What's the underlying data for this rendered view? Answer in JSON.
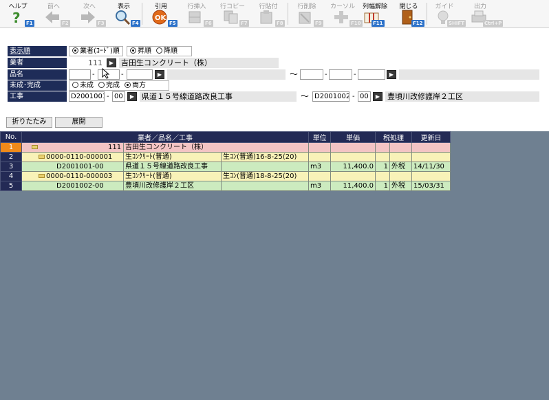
{
  "toolbar": {
    "help": {
      "label": "ヘルプ",
      "key": "F1"
    },
    "prev": {
      "label": "前へ",
      "key": "F2"
    },
    "next": {
      "label": "次へ",
      "key": "F3"
    },
    "display": {
      "label": "表示",
      "key": "F4"
    },
    "quote": {
      "label": "引用",
      "key": "F5"
    },
    "row_insert": {
      "label": "行挿入",
      "key": "F6"
    },
    "row_copy": {
      "label": "行コピー",
      "key": "F7"
    },
    "row_paste": {
      "label": "行貼付",
      "key": "F8"
    },
    "row_delete": {
      "label": "行削除",
      "key": "F9"
    },
    "cursor": {
      "label": "カーソル",
      "key": "F10"
    },
    "col_unlock": {
      "label": "列幅解除",
      "key": "F11"
    },
    "close": {
      "label": "閉じる",
      "key": "F12"
    },
    "guide": {
      "label": "ガイド",
      "key": "SHIFT"
    },
    "output": {
      "label": "出力",
      "key": "Ctrl+P"
    }
  },
  "form": {
    "order": {
      "label": "表示順",
      "options": [
        "業者(ｺｰﾄﾞ)順",
        "昇順",
        "降順"
      ]
    },
    "vendor": {
      "label": "業者",
      "code": "111",
      "name": "吉田生コンクリート（株）"
    },
    "item": {
      "label": "品名",
      "from": [
        "",
        "",
        ""
      ],
      "range_sep": "～",
      "to": [
        "",
        "",
        ""
      ]
    },
    "status": {
      "label": "未成･完成",
      "options": [
        "未成",
        "完成",
        "両方"
      ],
      "selected": "両方"
    },
    "project": {
      "label": "工事",
      "from_code": "D2001001",
      "from_branch": "00",
      "from_name": "県道１５号線道路改良工事",
      "range_sep": "～",
      "to_code": "D2001002",
      "to_branch": "00",
      "to_name": "豊頃川改修護岸２工区"
    }
  },
  "buttons": {
    "collapse": "折りたたみ",
    "expand": "展開"
  },
  "grid": {
    "headers": {
      "no": "No.",
      "main": "業者／品名／工事",
      "unit": "単位",
      "price": "単価",
      "tax": "税処理",
      "updated": "更新日"
    },
    "rows": [
      {
        "no": "1",
        "code": "111",
        "name": "吉田生コンクリート（株）",
        "spec": "",
        "unit": "",
        "price": "",
        "tax_n": "",
        "tax": "",
        "updated": ""
      },
      {
        "no": "2",
        "code": "0000-0110-000001",
        "name": "生ｺﾝｸﾘｰﾄ(普通)",
        "spec": "生ｺﾝ(普通)16-8-25(20)",
        "unit": "",
        "price": "",
        "tax_n": "",
        "tax": "",
        "updated": ""
      },
      {
        "no": "3",
        "code": "D2001001-00",
        "name": "県道１５号線道路改良工事",
        "spec": "",
        "unit": "m3",
        "price": "11,400.0",
        "tax_n": "1",
        "tax": "外税",
        "updated": "14/11/30"
      },
      {
        "no": "4",
        "code": "0000-0110-000003",
        "name": "生ｺﾝｸﾘｰﾄ(普通)",
        "spec": "生ｺﾝ(普通)18-8-25(20)",
        "unit": "",
        "price": "",
        "tax_n": "",
        "tax": "",
        "updated": ""
      },
      {
        "no": "5",
        "code": "D2001002-00",
        "name": "豊頃川改修護岸２工区",
        "spec": "",
        "unit": "m3",
        "price": "11,400.0",
        "tax_n": "1",
        "tax": "外税",
        "updated": "15/03/31"
      }
    ]
  }
}
